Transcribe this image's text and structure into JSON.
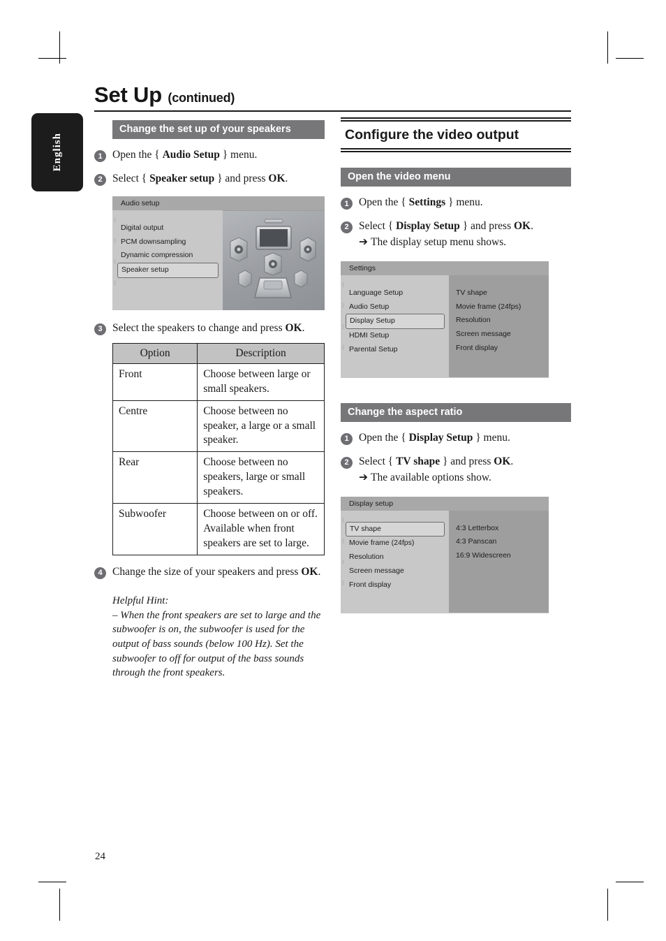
{
  "page": {
    "number": "24",
    "language_tab": "English",
    "title": "Set Up",
    "title_suffix": "(continued)"
  },
  "left_column": {
    "section_bar": "Change the set up of your speakers",
    "steps": [
      {
        "num": "1",
        "text_before": "Open the { ",
        "bold": "Audio Setup",
        "text_after": " } menu."
      },
      {
        "num": "2",
        "text_before": "Select { ",
        "bold": "Speaker setup",
        "text_after": " } and press ",
        "bold2": "OK",
        "text_end": "."
      }
    ],
    "audio_setup_screen": {
      "title": "Audio setup",
      "items": [
        "Digital output",
        "PCM downsampling",
        "Dynamic compression",
        "Speaker setup"
      ],
      "selected": "Speaker setup"
    },
    "step3": {
      "num": "3",
      "text": "Select the speakers to change and press ",
      "bold": "OK",
      "text_end": "."
    },
    "table": {
      "headers": [
        "Option",
        "Description"
      ],
      "rows": [
        [
          "Front",
          "Choose between large or small speakers."
        ],
        [
          "Centre",
          "Choose between no speaker, a large or a small speaker."
        ],
        [
          "Rear",
          "Choose between no speakers, large or small speakers."
        ],
        [
          "Subwoofer",
          "Choose between on or off. Available when front speakers are set to large."
        ]
      ]
    },
    "step4": {
      "num": "4",
      "text": "Change the size of your speakers and press ",
      "bold": "OK",
      "text_end": "."
    },
    "hint_title": "Helpful Hint:",
    "hint_body": "– When the front speakers are set to large and the subwoofer is on, the subwoofer is used for the output of bass sounds (below 100 Hz). Set the subwoofer to off for output of the bass sounds through the front speakers."
  },
  "right_column": {
    "heading": "Configure the video output",
    "section_bar_1": "Open the video menu",
    "steps_1": [
      {
        "num": "1",
        "text_before": "Open the { ",
        "bold": "Settings",
        "text_after": " } menu."
      },
      {
        "num": "2",
        "text_before": "Select { ",
        "bold": "Display Setup",
        "text_after": " } and press ",
        "bold2": "OK",
        "text_end": ".",
        "sub_arrow": "➔",
        "sub": "The display setup menu shows."
      }
    ],
    "settings_screen": {
      "title": "Settings",
      "left_items": [
        "Language Setup",
        "Audio Setup",
        "Display Setup",
        "HDMI Setup",
        "Parental Setup"
      ],
      "selected": "Display Setup",
      "right_items": [
        "TV shape",
        "Movie frame (24fps)",
        "Resolution",
        "Screen message",
        "Front display"
      ]
    },
    "section_bar_2": "Change the aspect ratio",
    "steps_2": [
      {
        "num": "1",
        "text_before": "Open the { ",
        "bold": "Display Setup",
        "text_after": " } menu."
      },
      {
        "num": "2",
        "text_before": "Select { ",
        "bold": "TV shape",
        "text_after": " } and press ",
        "bold2": "OK",
        "text_end": ".",
        "sub_arrow": "➔",
        "sub": "The available options show."
      }
    ],
    "display_setup_screen": {
      "title": "Display setup",
      "left_items": [
        "TV shape",
        "Movie frame (24fps)",
        "Resolution",
        "Screen message",
        "Front display"
      ],
      "selected": "TV shape",
      "right_items": [
        "4:3 Letterbox",
        "4:3 Panscan",
        "16:9 Widescreen"
      ]
    }
  },
  "colors": {
    "bar_grey": "#77777a",
    "tab_black": "#1c1c1c",
    "screen_title_grey": "#a8a8a8",
    "screen_left_grey": "#c8c8c8",
    "screen_right_grey": "#9e9e9e",
    "table_header_grey": "#c2c2c2"
  }
}
